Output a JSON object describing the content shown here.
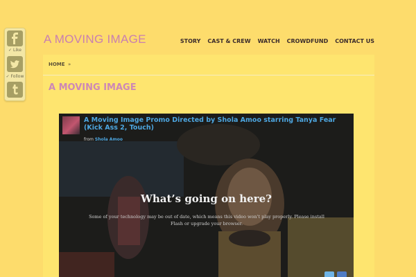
{
  "social": {
    "like_label": "Like",
    "follow_label": "Follow",
    "colors": {
      "facebook": "#a79f64",
      "twitter": "#a79f64",
      "tumblr": "#a79f64"
    }
  },
  "header": {
    "logo": "A MOVING IMAGE",
    "nav": [
      "STORY",
      "CAST & CREW",
      "WATCH",
      "CROWDFUND",
      "CONTACT US"
    ]
  },
  "breadcrumb": {
    "home": "HOME",
    "sep": "»"
  },
  "page": {
    "title": "A MOVING IMAGE"
  },
  "video": {
    "title": "A Moving Image Promo Directed by Shola Amoo starring Tanya Fear (Kick Ass 2, Touch)",
    "from_label": "from",
    "author": "Shola Amoo",
    "error_title": "What’s going on here?",
    "error_message": "Some of your technology may be out of date, which means this video won't play properly. Please install Flash or upgrade your browser."
  },
  "colors": {
    "background": "#fddc6c",
    "panel": "#fee56f",
    "logo": "#c97fb0",
    "title": "#cd88b6",
    "link": "#4da6e0"
  }
}
